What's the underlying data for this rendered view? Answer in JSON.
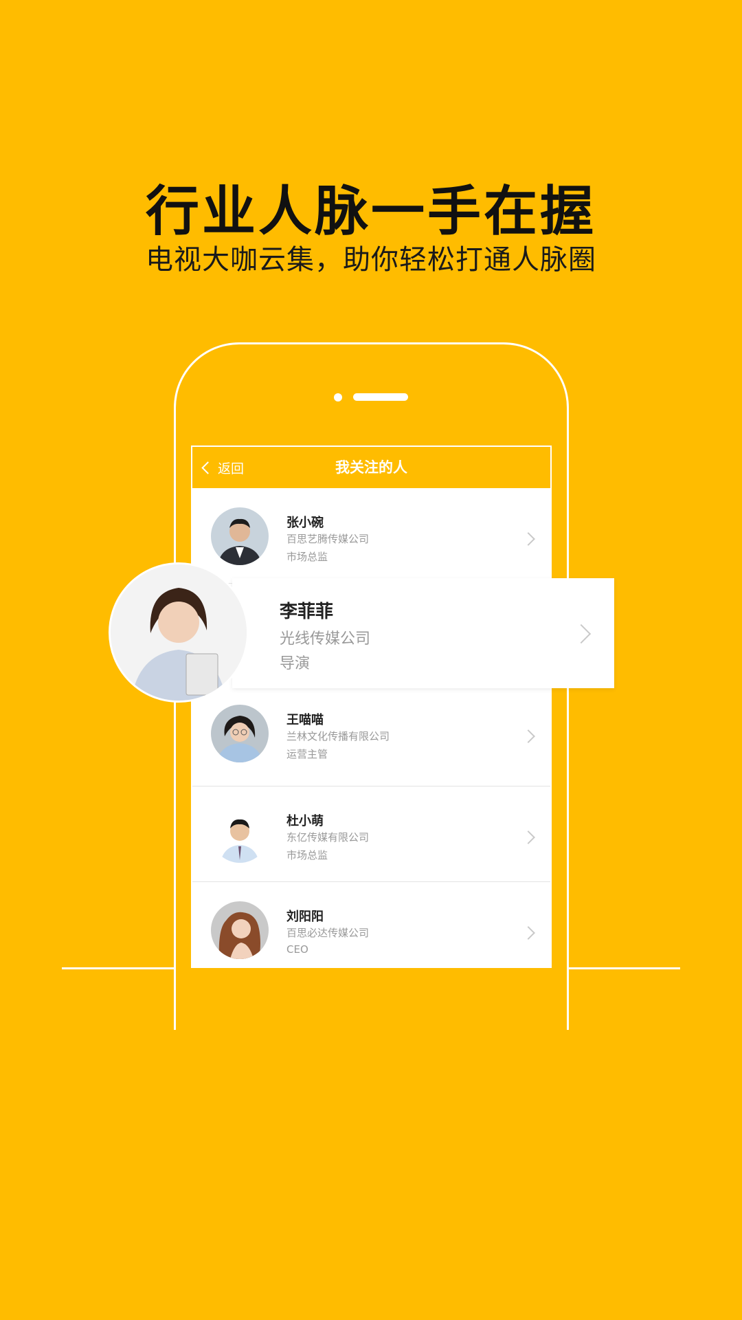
{
  "headline": "行业人脉一手在握",
  "subline": "电视大咖云集，助你轻松打通人脉圈",
  "screen": {
    "back_label": "返回",
    "title": "我关注的人"
  },
  "contacts": [
    {
      "name": "张小碗",
      "company": "百思艺腾传媒公司",
      "title": "市场总监"
    },
    {
      "name": "李菲菲",
      "company": "光线传媒公司",
      "title": "导演"
    },
    {
      "name": "王喵喵",
      "company": "兰林文化传播有限公司",
      "title": "运营主管"
    },
    {
      "name": "杜小萌",
      "company": "东亿传媒有限公司",
      "title": "市场总监"
    },
    {
      "name": "刘阳阳",
      "company": "百思必达传媒公司",
      "title": "CEO"
    }
  ],
  "colors": {
    "background": "#FFBC00",
    "navbar": "#FFBC00",
    "card": "#FFFFFF"
  }
}
